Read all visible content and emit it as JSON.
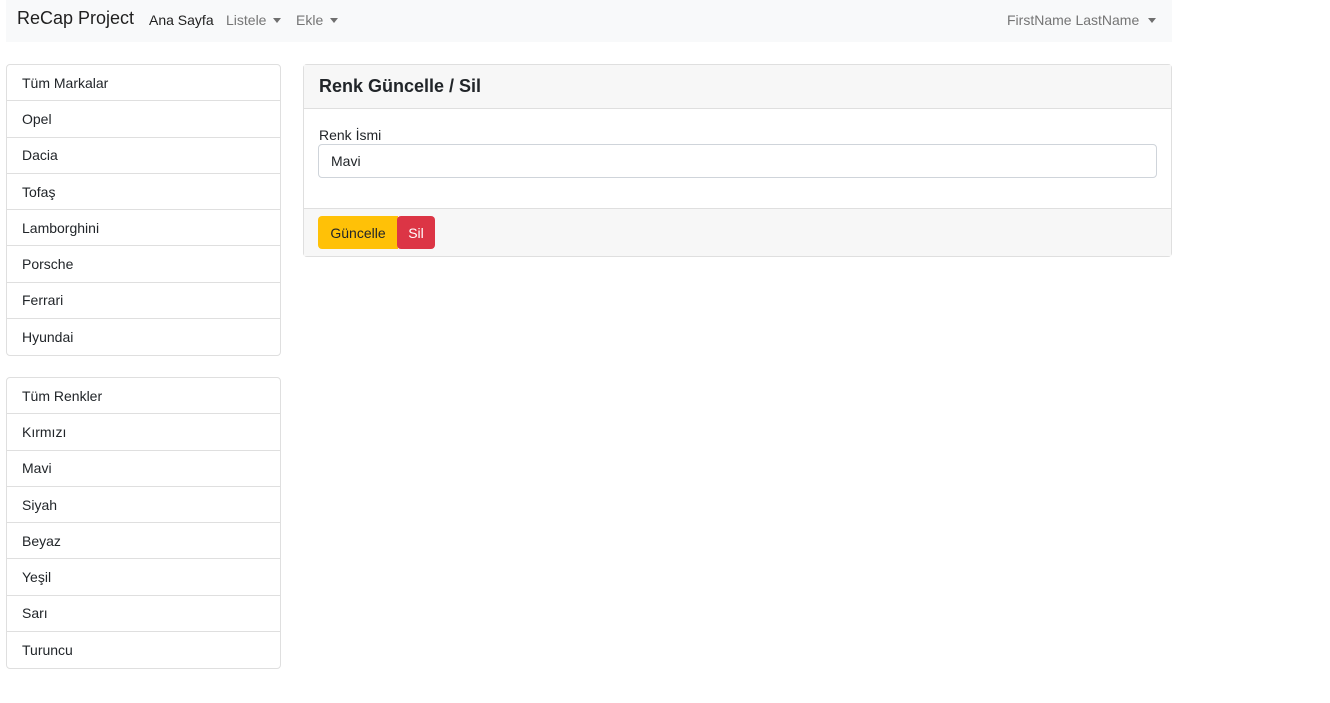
{
  "navbar": {
    "brand": "ReCap Project",
    "links": [
      {
        "label": "Ana Sayfa"
      },
      {
        "label": "Listele"
      },
      {
        "label": "Ekle"
      }
    ],
    "user": "FirstName LastName"
  },
  "brands": [
    "Tüm Markalar",
    "Opel",
    "Dacia",
    "Tofaş",
    "Lamborghini",
    "Porsche",
    "Ferrari",
    "Hyundai"
  ],
  "colors": [
    "Tüm Renkler",
    "Kırmızı",
    "Mavi",
    "Siyah",
    "Beyaz",
    "Yeşil",
    "Sarı",
    "Turuncu"
  ],
  "card": {
    "title": "Renk Güncelle / Sil",
    "field_label": "Renk İsmi",
    "field_value": "Mavi",
    "update_label": "Güncelle",
    "delete_label": "Sil"
  },
  "theme": {
    "navbar_bg": "#f8f9fa",
    "warning": "#ffc107",
    "danger": "#dc3545"
  }
}
